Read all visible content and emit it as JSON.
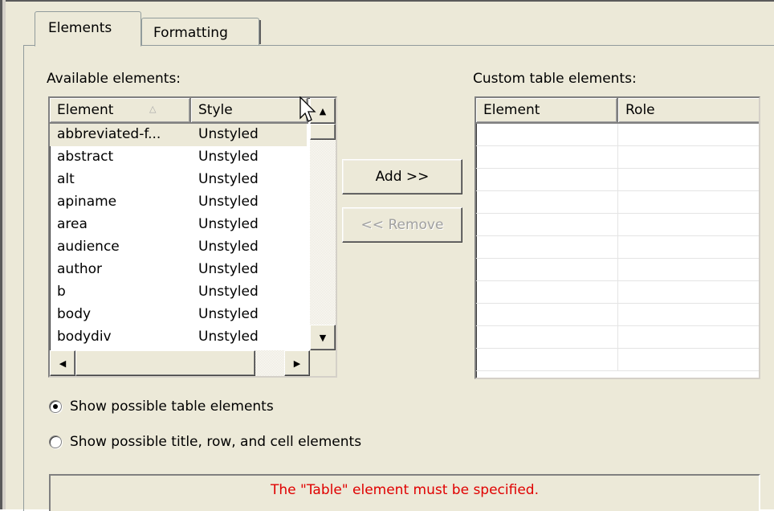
{
  "tabs": [
    {
      "label": "Elements",
      "active": true
    },
    {
      "label": "Formatting",
      "active": false
    }
  ],
  "available": {
    "label": "Available elements:",
    "columns": [
      {
        "label": "Element",
        "sort": "ascending"
      },
      {
        "label": "Style"
      }
    ],
    "rows": [
      {
        "element": "abbreviated-f...",
        "style": "Unstyled",
        "selected": true
      },
      {
        "element": "abstract",
        "style": "Unstyled"
      },
      {
        "element": "alt",
        "style": "Unstyled"
      },
      {
        "element": "apiname",
        "style": "Unstyled"
      },
      {
        "element": "area",
        "style": "Unstyled"
      },
      {
        "element": "audience",
        "style": "Unstyled"
      },
      {
        "element": "author",
        "style": "Unstyled"
      },
      {
        "element": "b",
        "style": "Unstyled"
      },
      {
        "element": "body",
        "style": "Unstyled"
      },
      {
        "element": "bodydiv",
        "style": "Unstyled"
      }
    ]
  },
  "buttons": {
    "add": "Add >>",
    "remove": "<< Remove"
  },
  "custom": {
    "label": "Custom table elements:",
    "columns": [
      {
        "label": "Element"
      },
      {
        "label": "Role"
      }
    ],
    "empty_rows": 11
  },
  "options": {
    "show_table": "Show possible table elements",
    "show_parts": "Show possible title, row, and cell elements",
    "selected": "show_table"
  },
  "message": "The \"Table\" element must be specified.",
  "colors": {
    "message": "#e00000",
    "dialog_bg": "#ece9d8"
  },
  "icons": {
    "sort": "sort-ascending-icon",
    "cursor": "mouse-pointer-icon"
  }
}
